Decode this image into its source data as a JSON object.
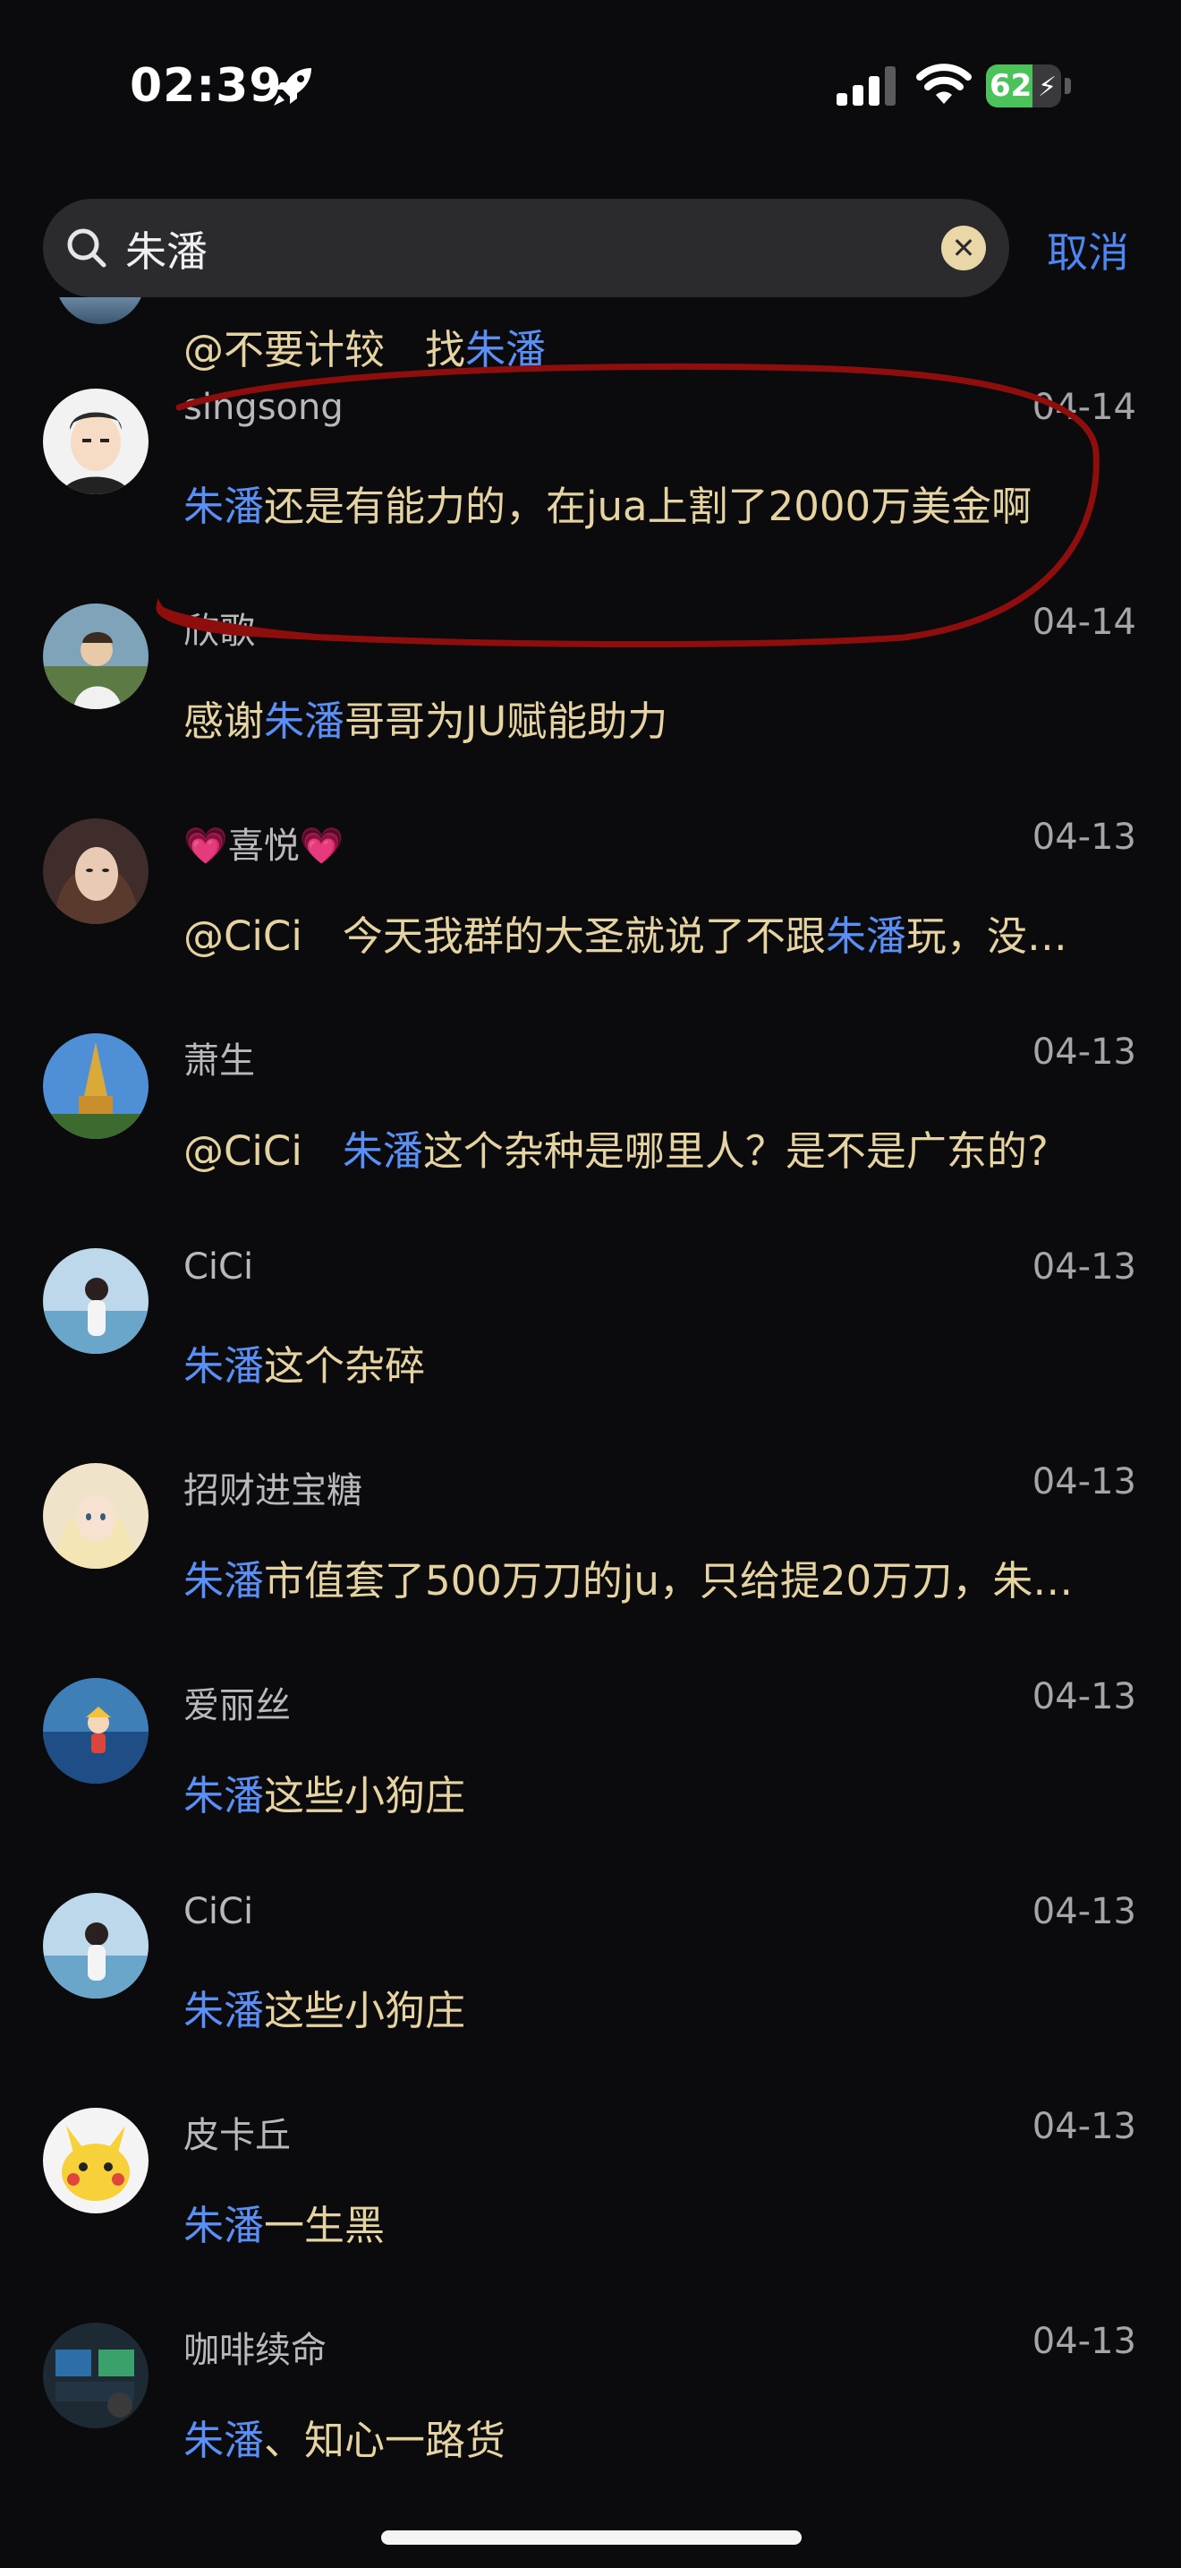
{
  "status": {
    "time": "02:39",
    "battery": "62",
    "battery_level": 0.62
  },
  "search": {
    "query": "朱潘",
    "cancel_label": "取消"
  },
  "partial_row": {
    "mention": "@不要计较",
    "text_before": "找",
    "keyword": "朱潘"
  },
  "results": [
    {
      "name": "singsong",
      "date": "04-14",
      "pre": "",
      "kw": "朱潘",
      "post": "还是有能力的，在jua上割了2000万美金啊",
      "avatar": "cartoon-man"
    },
    {
      "name": "欣歌",
      "date": "04-14",
      "pre": "感谢",
      "kw": "朱潘",
      "post": "哥哥为JU赋能助力",
      "avatar": "outdoor-portrait"
    },
    {
      "name": "💗喜悦💗",
      "date": "04-13",
      "pre": "@CiCi　今天我群的大圣就说了不跟",
      "kw": "朱潘",
      "post": "玩，没…",
      "avatar": "woman-portrait"
    },
    {
      "name": "萧生",
      "date": "04-13",
      "pre": "@CiCi　",
      "kw": "朱潘",
      "post": "这个杂种是哪里人？是不是广东的?",
      "avatar": "golden-tower"
    },
    {
      "name": "CiCi",
      "date": "04-13",
      "pre": "",
      "kw": "朱潘",
      "post": "这个杂碎",
      "avatar": "beach-girl"
    },
    {
      "name": "招财进宝糖",
      "date": "04-13",
      "pre": "",
      "kw": "朱潘",
      "post": "市值套了500万刀的ju，只给提20万刀，朱…",
      "avatar": "anime-girl"
    },
    {
      "name": "爱丽丝",
      "date": "04-13",
      "pre": "",
      "kw": "朱潘",
      "post": "这些小狗庄",
      "avatar": "sea-cartoon"
    },
    {
      "name": "CiCi",
      "date": "04-13",
      "pre": "",
      "kw": "朱潘",
      "post": "这些小狗庄",
      "avatar": "beach-girl"
    },
    {
      "name": "皮卡丘",
      "date": "04-13",
      "pre": "",
      "kw": "朱潘",
      "post": "一生黑",
      "avatar": "pikachu"
    },
    {
      "name": "咖啡续命",
      "date": "04-13",
      "pre": "",
      "kw": "朱潘",
      "post": "、知心一路货",
      "avatar": "trader-screens"
    }
  ]
}
